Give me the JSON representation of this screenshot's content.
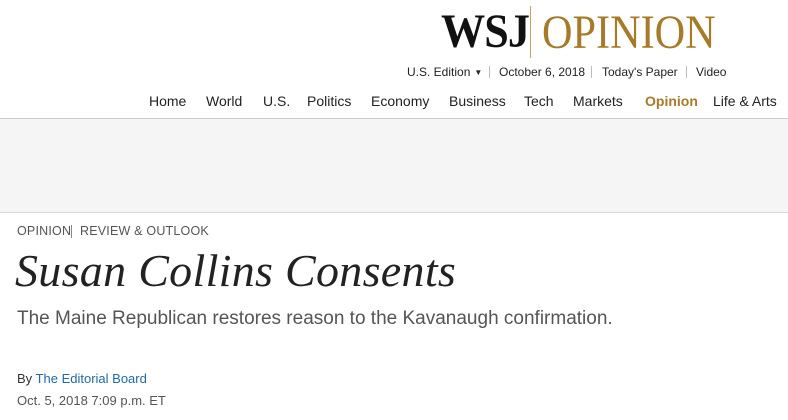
{
  "header": {
    "logo": {
      "wsj": "WSJ",
      "section": "OPINION"
    },
    "utility": {
      "edition": "U.S. Edition",
      "date": "October 6, 2018",
      "todays_paper": "Today's Paper",
      "video": "Video"
    },
    "nav": [
      {
        "label": "Home"
      },
      {
        "label": "World"
      },
      {
        "label": "U.S."
      },
      {
        "label": "Politics"
      },
      {
        "label": "Economy"
      },
      {
        "label": "Business"
      },
      {
        "label": "Tech"
      },
      {
        "label": "Markets"
      },
      {
        "label": "Opinion",
        "active": true
      },
      {
        "label": "Life & Arts"
      }
    ]
  },
  "article": {
    "breadcrumb": [
      "Opinion",
      "Review & Outlook"
    ],
    "headline": "Susan Collins Consents",
    "dek": "The Maine Republican restores reason to the Kavanaugh confirmation.",
    "byline": {
      "prefix": "By",
      "author": "The Editorial Board"
    },
    "timestamp": "Oct. 5, 2018 7:09 p.m. ET"
  },
  "colors": {
    "brand_gold": "#a67a27",
    "link_blue": "#1f6aa5",
    "ad_band_bg": "#f5f5f5"
  }
}
